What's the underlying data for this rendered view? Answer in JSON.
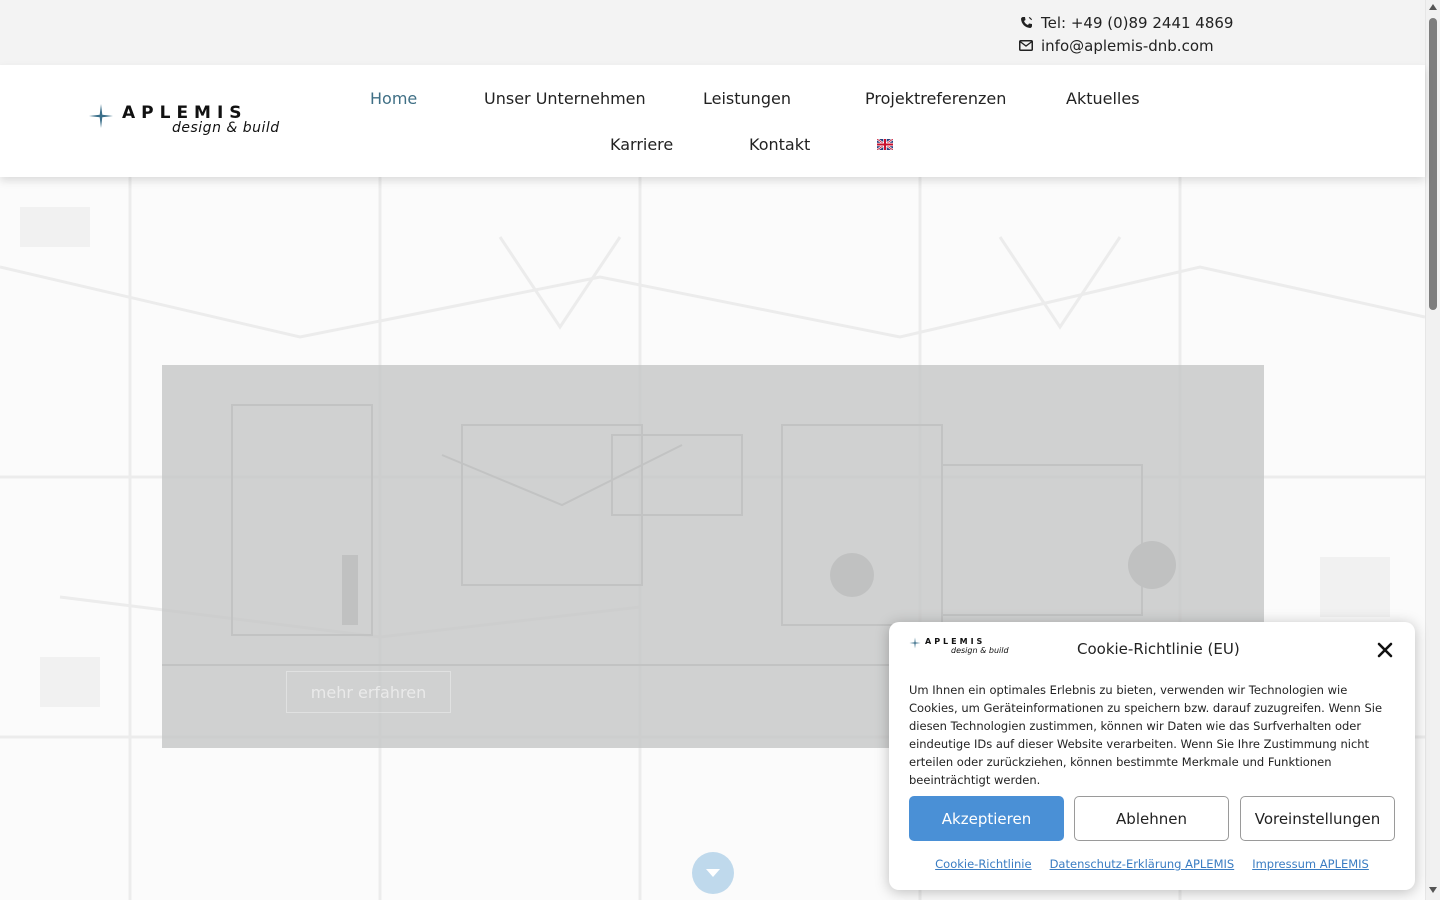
{
  "topbar": {
    "phone": "Tel: +49 (0)89 2441 4869",
    "email": "info@aplemis-dnb.com",
    "icons": [
      "phone-icon",
      "envelope-icon"
    ]
  },
  "logo": {
    "brand": "APLEMIS",
    "tagline": "design & build"
  },
  "nav": {
    "items": [
      {
        "label": "Home",
        "active": true
      },
      {
        "label": "Unser Unternehmen"
      },
      {
        "label": "Leistungen"
      },
      {
        "label": "Projektreferenzen"
      },
      {
        "label": "Aktuelles"
      },
      {
        "label": "Karriere"
      },
      {
        "label": "Kontakt"
      }
    ],
    "language_icon": "uk-flag-icon"
  },
  "hero": {
    "more_button": "mehr erfahren",
    "scroll_icon": "chevron-down-icon"
  },
  "cookie": {
    "title": "Cookie-Richtlinie (EU)",
    "text": "Um Ihnen ein optimales Erlebnis zu bieten, verwenden wir Technologien wie Cookies, um Geräteinformationen zu speichern bzw. darauf zuzugreifen. Wenn Sie diesen Technologien zustimmen, können wir Daten wie das Surfverhalten oder eindeutige IDs auf dieser Website verarbeiten. Wenn Sie Ihre Zustimmung nicht erteilen oder zurückziehen, können bestimmte Merkmale und Funktionen beeinträchtigt werden.",
    "accept": "Akzeptieren",
    "deny": "Ablehnen",
    "preferences": "Voreinstellungen",
    "links": [
      "Cookie-Richtlinie",
      "Datenschutz-Erklärung APLEMIS",
      "Impressum APLEMIS"
    ]
  },
  "colors": {
    "accent": "#4a90d6",
    "nav_active": "#3f6f85",
    "scroll_button": "#bfd9ec"
  }
}
